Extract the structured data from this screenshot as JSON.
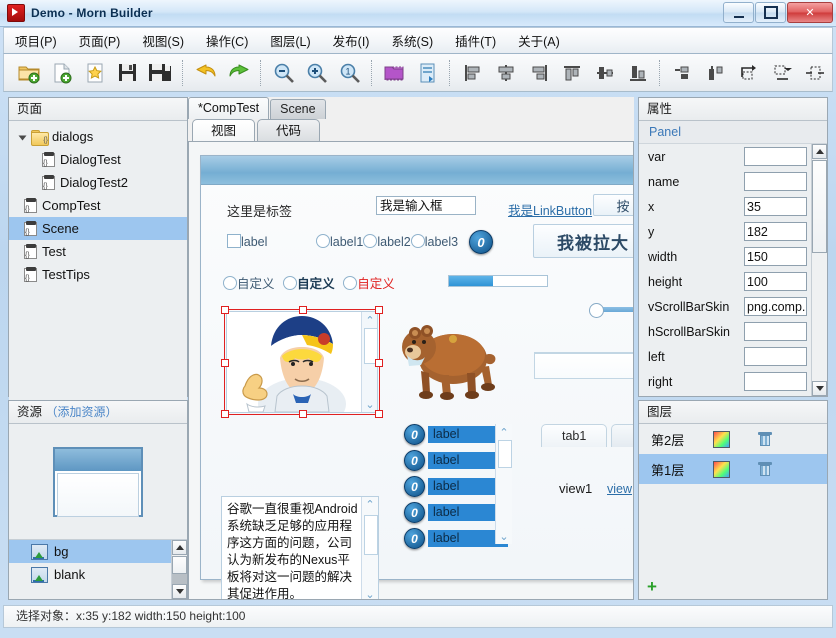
{
  "window": {
    "title": "Demo - Morn Builder",
    "minimize": "—",
    "maximize": "□",
    "close": "✕"
  },
  "menubar": {
    "items": [
      {
        "label": "项目(P)"
      },
      {
        "label": "页面(P)"
      },
      {
        "label": "视图(S)"
      },
      {
        "label": "操作(C)"
      },
      {
        "label": "图层(L)"
      },
      {
        "label": "发布(I)"
      },
      {
        "label": "系统(S)"
      },
      {
        "label": "插件(T)"
      },
      {
        "label": "关于(A)"
      }
    ]
  },
  "toolbar": {
    "buttons": [
      {
        "name": "open-project-icon"
      },
      {
        "name": "new-file-icon"
      },
      {
        "name": "new-page-icon"
      },
      {
        "name": "save-icon"
      },
      {
        "name": "save-all-icon"
      },
      {
        "name": "undo-icon"
      },
      {
        "name": "redo-icon"
      },
      {
        "name": "zoom-out-icon"
      },
      {
        "name": "zoom-in-icon"
      },
      {
        "name": "zoom-reset-icon"
      },
      {
        "name": "component-icon"
      },
      {
        "name": "export-icon"
      },
      {
        "name": "align-left-icon"
      },
      {
        "name": "align-center-h-icon"
      },
      {
        "name": "align-right-icon"
      },
      {
        "name": "align-top-icon"
      },
      {
        "name": "align-middle-v-icon"
      },
      {
        "name": "align-bottom-icon"
      },
      {
        "name": "distribute-h-icon"
      },
      {
        "name": "distribute-v-icon"
      },
      {
        "name": "size-match-icon"
      },
      {
        "name": "size-fit-icon"
      },
      {
        "name": "stretch-icon"
      }
    ]
  },
  "pages_panel": {
    "title": "页面",
    "items": [
      {
        "label": "dialogs",
        "type": "folder",
        "depth": 0,
        "expanded": true,
        "selected": false
      },
      {
        "label": "DialogTest",
        "type": "page",
        "depth": 2,
        "selected": false
      },
      {
        "label": "DialogTest2",
        "type": "page",
        "depth": 2,
        "selected": false
      },
      {
        "label": "CompTest",
        "type": "page",
        "depth": 1,
        "selected": false
      },
      {
        "label": "Scene",
        "type": "page",
        "depth": 1,
        "selected": true
      },
      {
        "label": "Test",
        "type": "page",
        "depth": 1,
        "selected": false
      },
      {
        "label": "TestTips",
        "type": "page",
        "depth": 1,
        "selected": false
      }
    ]
  },
  "resource_panel": {
    "title": "资源",
    "add_link": "（添加资源）",
    "items": [
      {
        "label": "bg",
        "selected": true
      },
      {
        "label": "blank",
        "selected": false
      }
    ]
  },
  "editor": {
    "doc_tabs": [
      {
        "label": "*CompTest",
        "active": true
      },
      {
        "label": "Scene",
        "active": false
      }
    ],
    "sub_tabs": [
      {
        "label": "视图",
        "active": true
      },
      {
        "label": "代码",
        "active": false
      }
    ],
    "canvas": {
      "label_text": "这里是标签",
      "input_value": "我是输入框",
      "link_button": "我是LinkButton",
      "checkbox_label": "label",
      "radio_labels": [
        "label1",
        "label2",
        "label3"
      ],
      "badge_text": "0",
      "big_button": "我被拉大",
      "custom_radios": [
        "自定义",
        "自定义",
        "自定义"
      ],
      "progress_percent": 45,
      "slider_value": 0,
      "textarea_text": "谷歌一直很重视Android系统缺乏足够的应用程序这方面的问题，公司认为新发布的Nexus平板将对这一问题的解决其促进作用。",
      "list_items": [
        "label",
        "label",
        "label",
        "label",
        "label"
      ],
      "list_badge": "0",
      "tab_label": "tab1",
      "view_label": "view1",
      "view_link": "view"
    }
  },
  "property_panel": {
    "title": "属性",
    "subtitle": "Panel",
    "rows": [
      {
        "key": "var",
        "value": ""
      },
      {
        "key": "name",
        "value": ""
      },
      {
        "key": "x",
        "value": "35"
      },
      {
        "key": "y",
        "value": "182"
      },
      {
        "key": "width",
        "value": "150"
      },
      {
        "key": "height",
        "value": "100"
      },
      {
        "key": "vScrollBarSkin",
        "value": "png.comp."
      },
      {
        "key": "hScrollBarSkin",
        "value": ""
      },
      {
        "key": "left",
        "value": ""
      },
      {
        "key": "right",
        "value": ""
      }
    ]
  },
  "layer_panel": {
    "title": "图层",
    "add_label": "+",
    "rows": [
      {
        "label": "第2层",
        "selected": false
      },
      {
        "label": "第1层",
        "selected": true
      }
    ]
  },
  "statusbar": {
    "text": "选择对象：x:35 y:182  width:150 height:100"
  },
  "colors": {
    "selection_blue": "#9dc6ef",
    "accent_link": "#3b78b8",
    "selection_red": "#e02020",
    "stage_header": "#75aed3",
    "list_item_blue": "#2b87d3"
  }
}
